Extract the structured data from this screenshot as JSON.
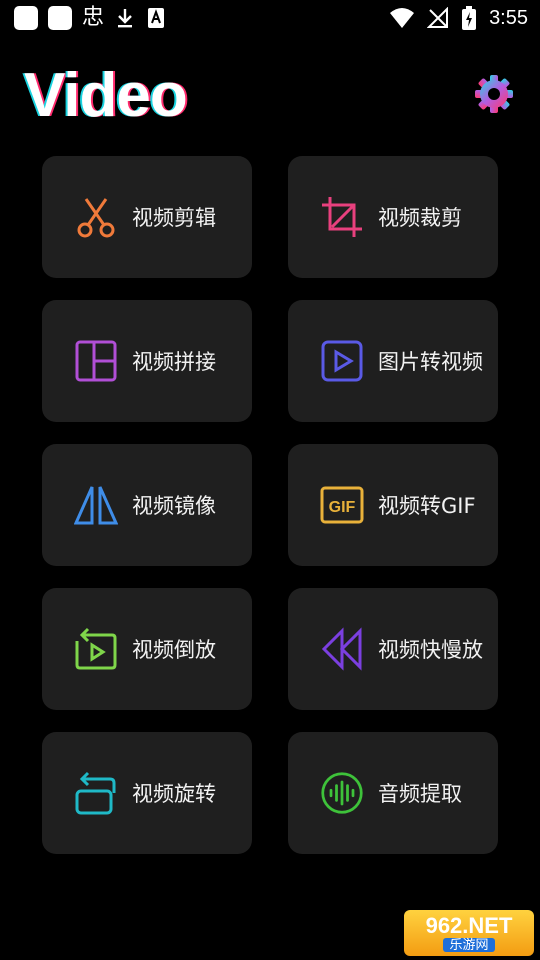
{
  "status_bar": {
    "left_glyph_1": "忠",
    "time": "3:55",
    "icons": [
      "square-icon",
      "square-icon",
      "download-icon",
      "sim-icon",
      "wifi-icon",
      "no-signal-icon",
      "battery-charging-icon"
    ]
  },
  "header": {
    "title": "Video",
    "settings_icon": "gear-icon"
  },
  "menu": {
    "items": [
      {
        "label": "视频剪辑",
        "icon": "scissors-icon",
        "color": "#f07a3a"
      },
      {
        "label": "视频裁剪",
        "icon": "crop-icon",
        "color": "#e8407e"
      },
      {
        "label": "视频拼接",
        "icon": "collage-icon",
        "color": "#b14fd6"
      },
      {
        "label": "图片转视频",
        "icon": "play-box-icon",
        "color": "#5a5ae6"
      },
      {
        "label": "视频镜像",
        "icon": "mirror-icon",
        "color": "#3f8de8"
      },
      {
        "label": "视频转GIF",
        "icon": "gif-icon",
        "color": "#e8b13a"
      },
      {
        "label": "视频倒放",
        "icon": "reverse-play-icon",
        "color": "#7fd64a"
      },
      {
        "label": "视频快慢放",
        "icon": "rewind-icon",
        "color": "#7b3fe0"
      },
      {
        "label": "视频旋转",
        "icon": "rotate-icon",
        "color": "#1fb9c7"
      },
      {
        "label": "音频提取",
        "icon": "audio-wave-icon",
        "color": "#3ec23a"
      }
    ]
  },
  "watermark": {
    "top": "962.NET",
    "bottom": "乐游网"
  }
}
